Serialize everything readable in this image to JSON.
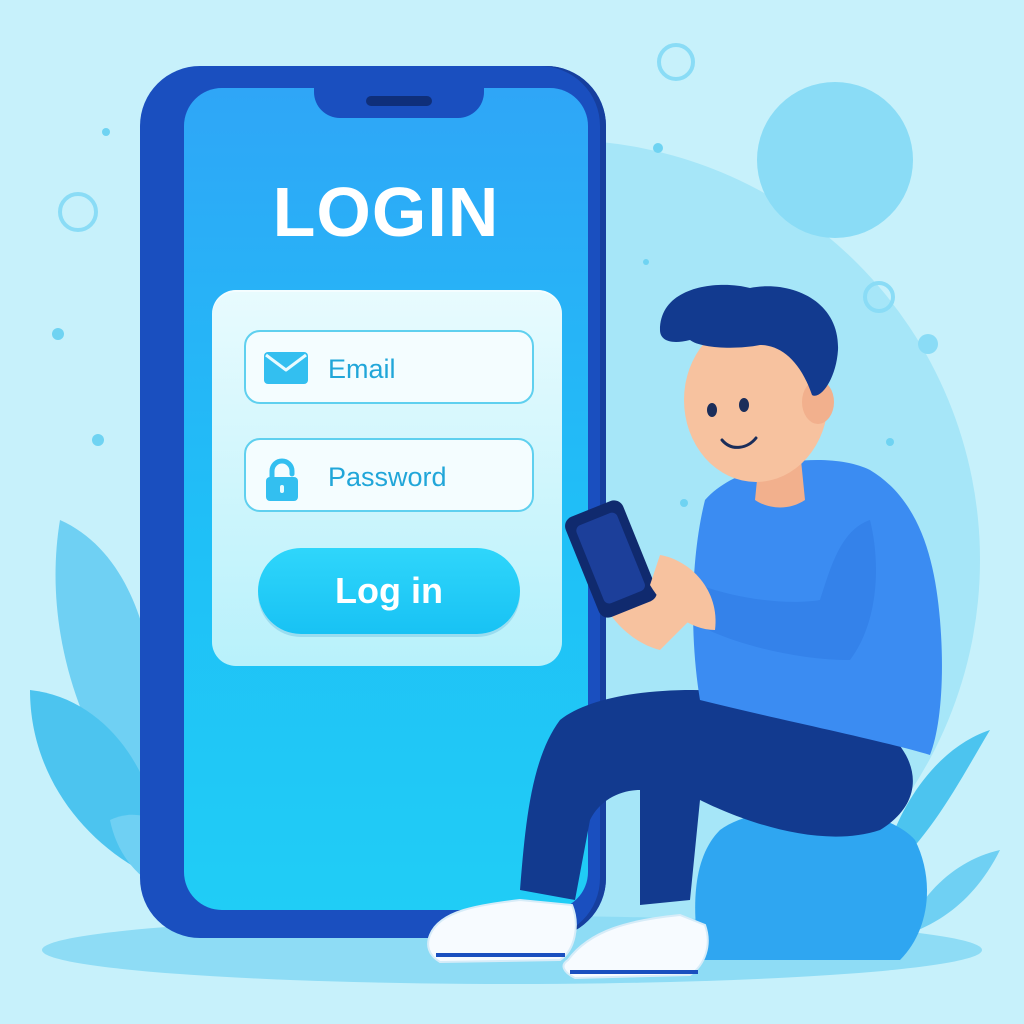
{
  "login": {
    "title": "LOGIN",
    "email_placeholder": "Email",
    "password_placeholder": "Password",
    "submit_label": "Log in"
  },
  "icons": {
    "email": "envelope-icon",
    "password": "padlock-icon"
  },
  "colors": {
    "background": "#c7f1fb",
    "phone_frame": "#1a4fbf",
    "screen": "#1fc0f7",
    "accent": "#21a6d9",
    "button": "#1dcaf6"
  }
}
